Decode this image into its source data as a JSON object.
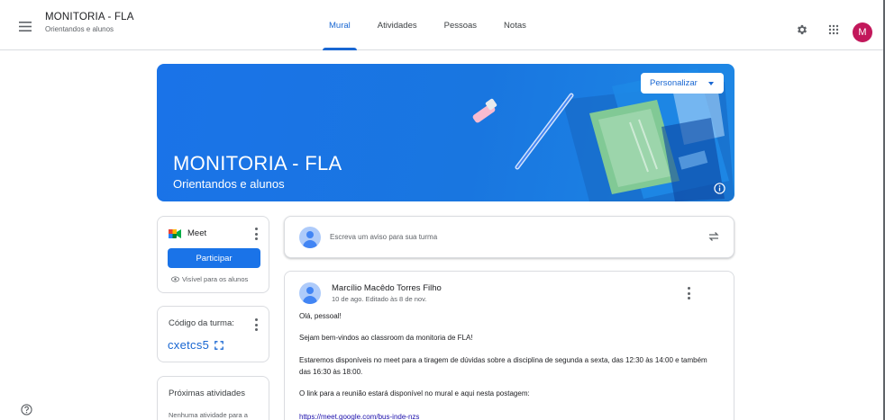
{
  "header": {
    "class_title": "MONITORIA - FLA",
    "class_subtitle": "Orientandos e alunos",
    "tabs": [
      {
        "label": "Mural",
        "active": true
      },
      {
        "label": "Atividades",
        "active": false
      },
      {
        "label": "Pessoas",
        "active": false
      },
      {
        "label": "Notas",
        "active": false
      }
    ],
    "icons": [
      "menu-icon",
      "settings-icon",
      "apps-grid-icon"
    ],
    "avatar_letter": "M"
  },
  "banner": {
    "title": "MONITORIA - FLA",
    "subtitle": "Orientandos e alunos",
    "customize_label": "Personalizar"
  },
  "meet": {
    "label": "Meet",
    "join_label": "Participar",
    "visibility_note": "Visível para os alunos"
  },
  "class_code": {
    "label": "Código da turma:",
    "value": "cxetcs5"
  },
  "upcoming": {
    "title": "Próximas atividades",
    "body": "Nenhuma atividade para a"
  },
  "compose": {
    "placeholder": "Escreva um aviso para sua turma"
  },
  "post": {
    "author": "Marcílio Macêdo Torres Filho",
    "date": "10 de ago. Editado às 8 de nov.",
    "lines": [
      "Olá, pessoal!",
      "Sejam bem-vindos ao classroom da monitoria de FLA!",
      "Estaremos disponíveis no meet para a tiragem de dúvidas sobre a disciplina de segunda a sexta, das 12:30 às 14:00 e também",
      "das 16:30 às 18:00.",
      "O link para a reunião estará disponível no mural e aqui nesta postagem:"
    ],
    "link": "https://meet.google.com/bus-inde-nzs"
  },
  "colors": {
    "primary": "#1a73e8",
    "link": "#1967d2",
    "avatar": "#c2185b",
    "border": "#dadce0"
  }
}
